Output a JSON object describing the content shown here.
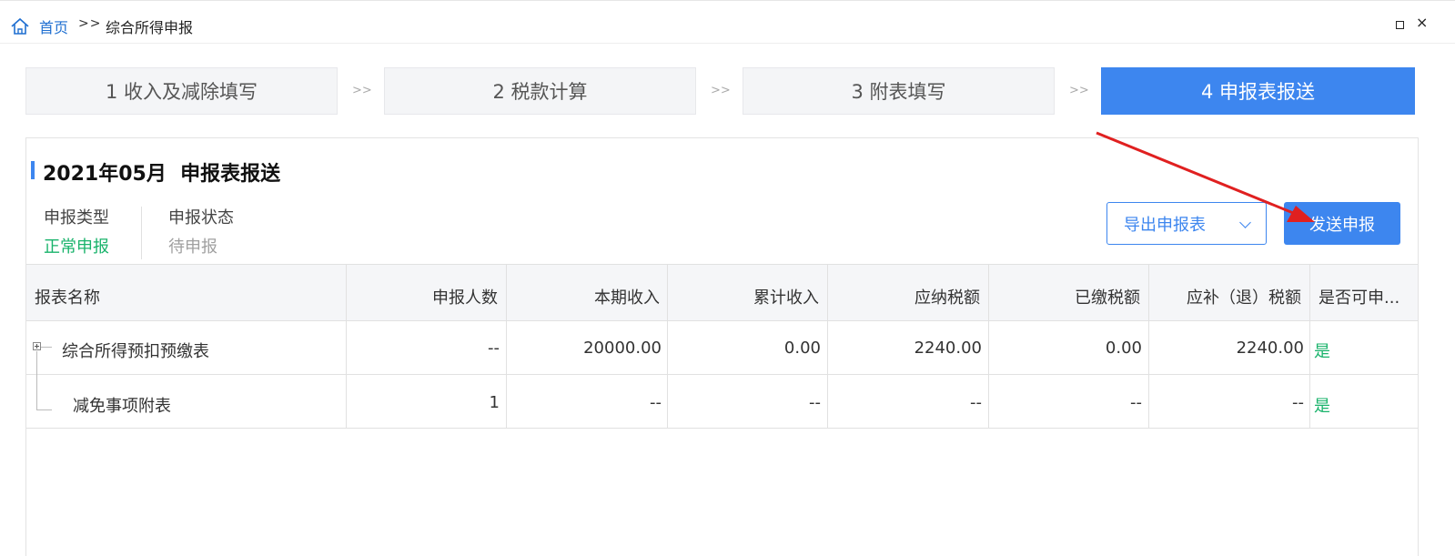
{
  "breadcrumb": {
    "home": "首页",
    "separator": ">>",
    "current": "综合所得申报",
    "home_icon": "home-icon"
  },
  "window_controls": {
    "restore_icon": "restore-icon",
    "close": "×"
  },
  "steps": [
    {
      "label": "1 收入及减除填写",
      "active": false
    },
    {
      "label": "2 税款计算",
      "active": false
    },
    {
      "label": "3 附表填写",
      "active": false
    },
    {
      "label": "4 申报表报送",
      "active": true
    }
  ],
  "step_separator": ">>",
  "panel": {
    "title": "2021年05月  申报表报送",
    "type_label": "申报类型",
    "type_value": "正常申报",
    "status_label": "申报状态",
    "status_value": "待申报",
    "export_button": "导出申报表",
    "send_button": "发送申报"
  },
  "table": {
    "columns": [
      "报表名称",
      "申报人数",
      "本期收入",
      "累计收入",
      "应纳税额",
      "已缴税额",
      "应补（退）税额",
      "是否可申..."
    ],
    "rows": [
      {
        "name": "综合所得预扣预缴表",
        "count": "--",
        "income": "20000.00",
        "cumulative": "0.00",
        "payable": "2240.00",
        "paid": "0.00",
        "refund": "2240.00",
        "can_file": "是"
      },
      {
        "name": "减免事项附表",
        "count": "1",
        "income": "--",
        "cumulative": "--",
        "payable": "--",
        "paid": "--",
        "refund": "--",
        "can_file": "是"
      }
    ]
  },
  "colors": {
    "accent": "#3d86ef",
    "success": "#19b36b",
    "annotation_arrow": "#e02020"
  }
}
